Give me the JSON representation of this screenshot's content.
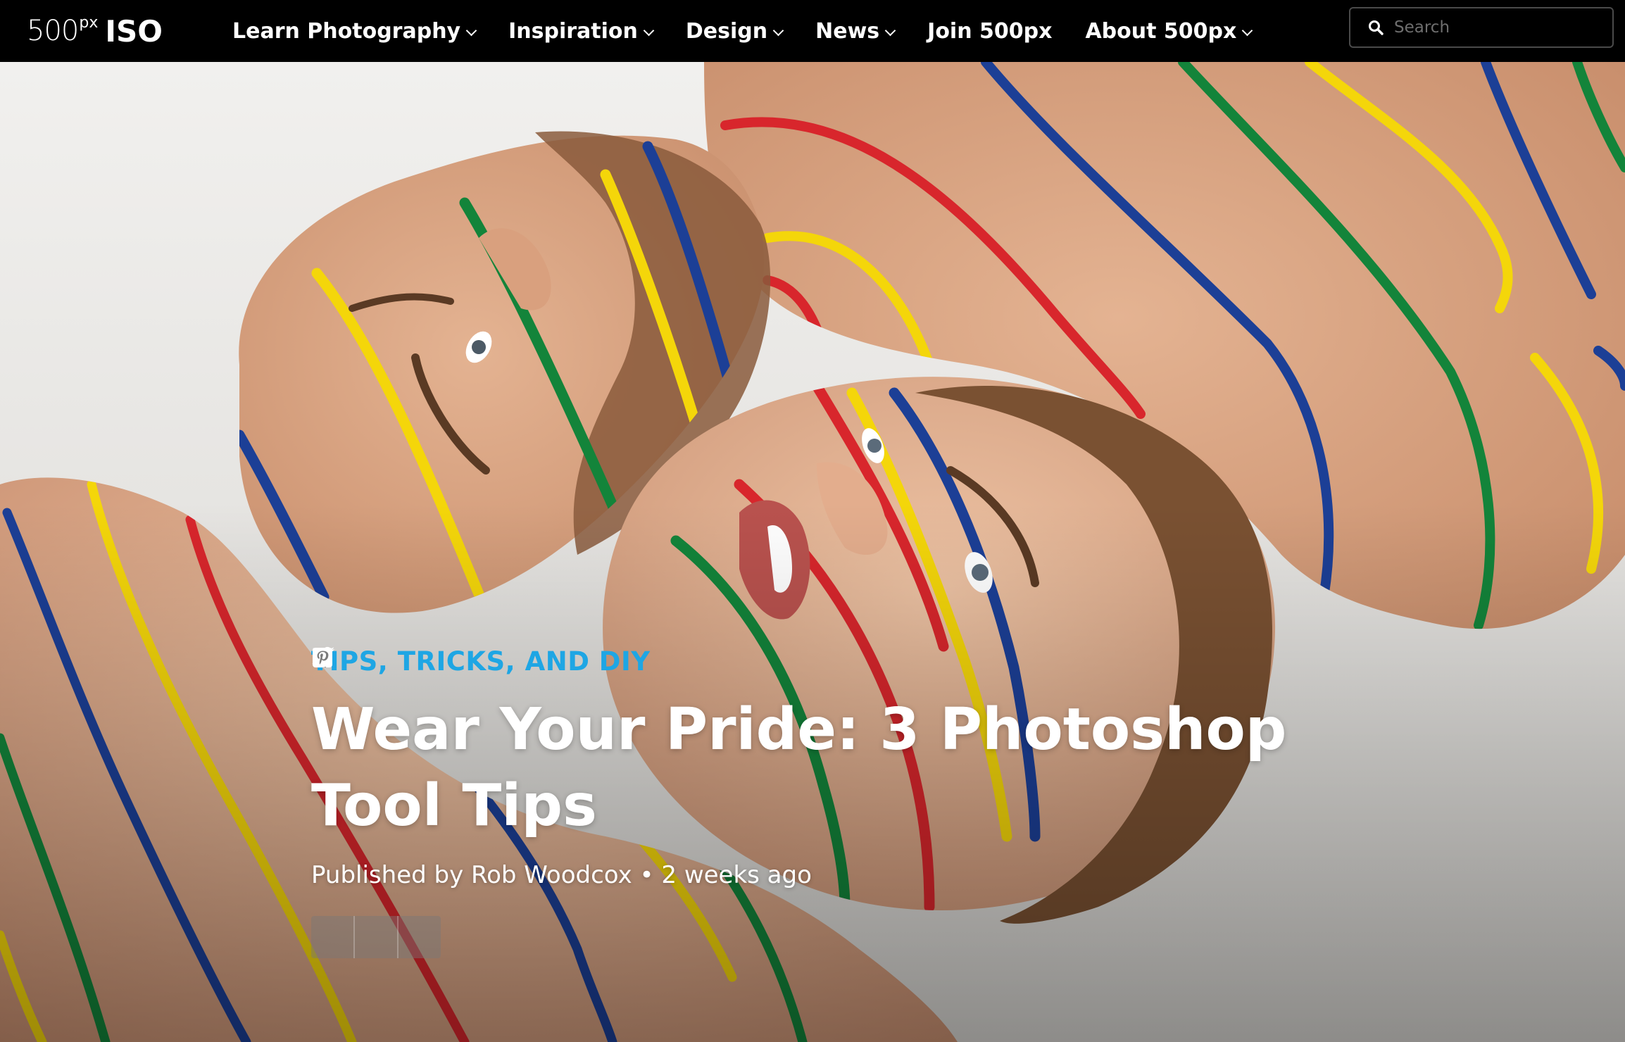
{
  "logo": {
    "brand_number": "500",
    "brand_suffix": "px",
    "product": "ISO"
  },
  "nav": {
    "items": [
      {
        "label": "Learn Photography",
        "has_dropdown": true
      },
      {
        "label": "Inspiration",
        "has_dropdown": true
      },
      {
        "label": "Design",
        "has_dropdown": true
      },
      {
        "label": "News",
        "has_dropdown": true
      },
      {
        "label": "Join 500px",
        "has_dropdown": false
      },
      {
        "label": "About 500px",
        "has_dropdown": true
      }
    ]
  },
  "search": {
    "placeholder": "Search",
    "value": "",
    "icon": "search-icon"
  },
  "article": {
    "category": "TIPS, TRICKS, AND DIY",
    "title": "Wear Your Pride: 3 Photoshop Tool Tips",
    "byline_prefix": "Published by",
    "author": "Rob Woodcox",
    "separator": "•",
    "published": "2 weeks ago"
  },
  "share": {
    "buttons": [
      {
        "icon": "facebook-icon"
      },
      {
        "icon": "twitter-icon"
      },
      {
        "icon": "pinterest-icon"
      }
    ]
  },
  "colors": {
    "nav_bg": "#000000",
    "nav_text": "#ffffff",
    "category": "#1ea6e4",
    "stripe_red": "#d8262c",
    "stripe_yellow": "#f4d60a",
    "stripe_green": "#13843a",
    "stripe_blue": "#1c3f96"
  },
  "hero": {
    "subject": "hero-photo"
  }
}
